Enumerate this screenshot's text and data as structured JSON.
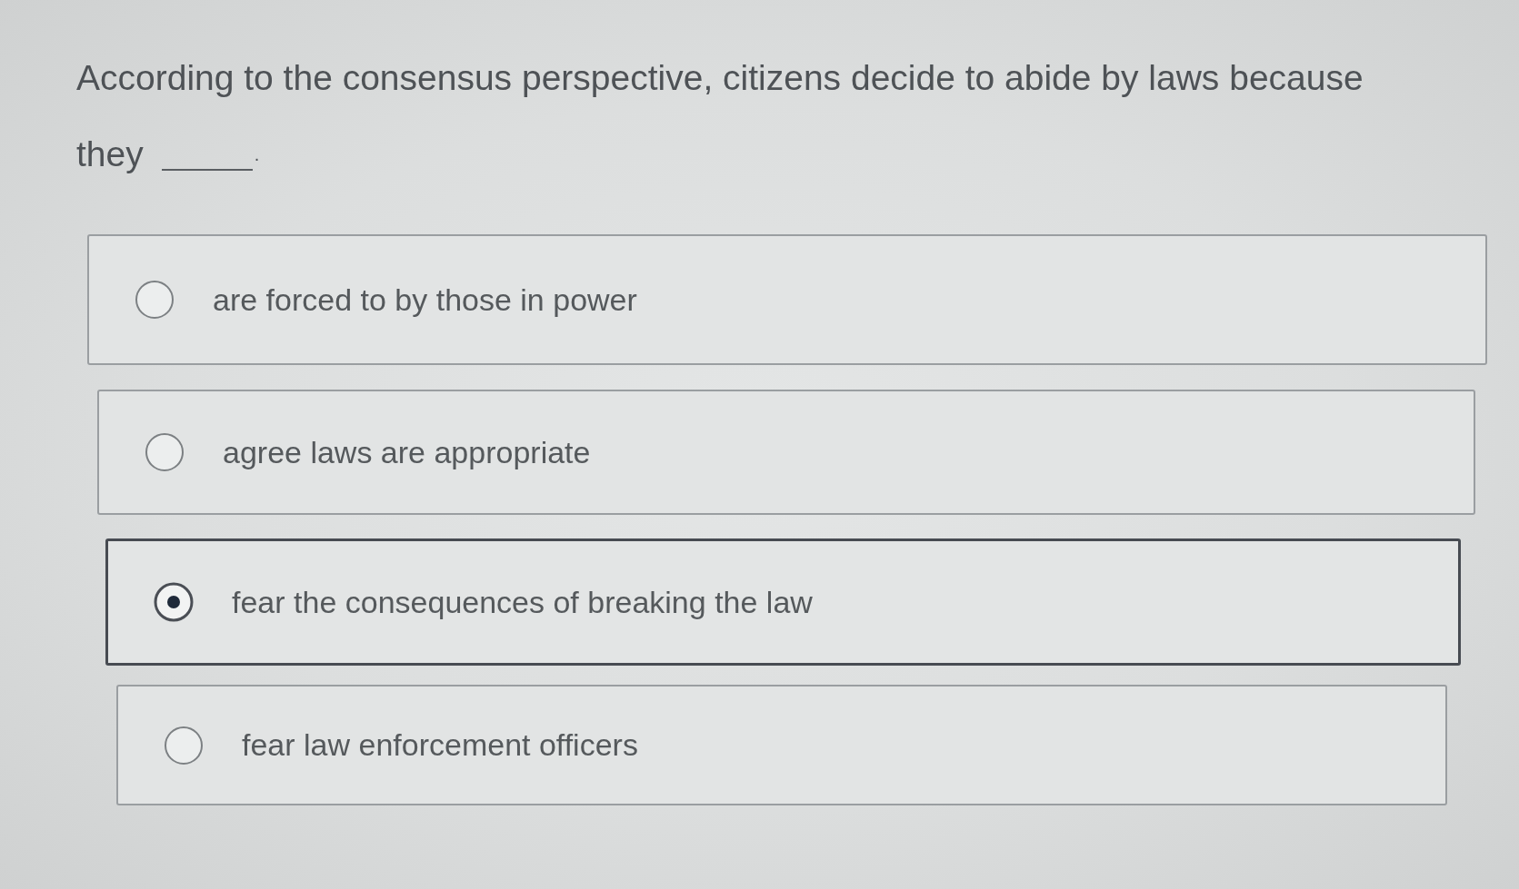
{
  "question": {
    "lines": [
      "According to the consensus perspective, citizens decide to abide by laws because",
      "they"
    ],
    "after_blank": "."
  },
  "options": [
    {
      "label": "are forced to by those in power",
      "selected": false
    },
    {
      "label": "agree laws are appropriate",
      "selected": false
    },
    {
      "label": "fear the consequences of breaking the law",
      "selected": true
    },
    {
      "label": "fear law enforcement officers",
      "selected": false
    }
  ]
}
